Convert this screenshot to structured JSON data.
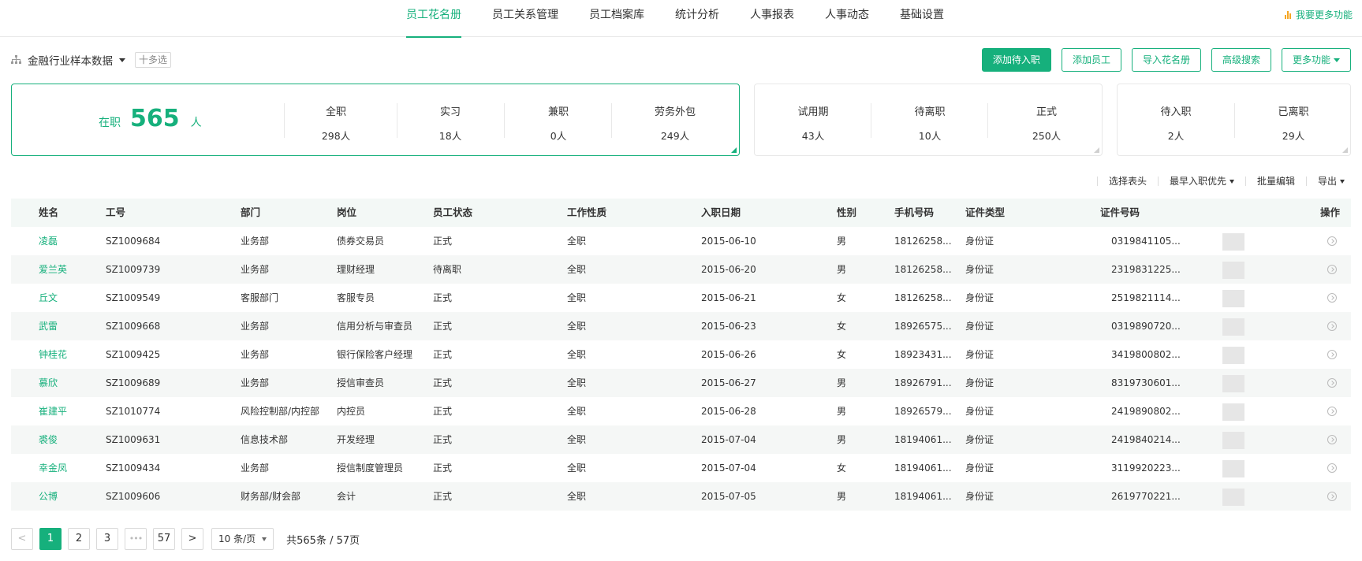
{
  "nav": {
    "tabs": [
      {
        "label": "员工花名册",
        "active": true
      },
      {
        "label": "员工关系管理",
        "active": false
      },
      {
        "label": "员工档案库",
        "active": false
      },
      {
        "label": "统计分析",
        "active": false
      },
      {
        "label": "人事报表",
        "active": false
      },
      {
        "label": "人事动态",
        "active": false
      },
      {
        "label": "基础设置",
        "active": false
      }
    ],
    "more_label": "我要更多功能"
  },
  "toolbar": {
    "dataset_label": "金融行业样本数据",
    "multi_label": "十多选",
    "buttons": [
      "添加待入职",
      "添加员工",
      "导入花名册",
      "高级搜索",
      "更多功能"
    ]
  },
  "stats": {
    "main": {
      "label": "在职",
      "value": "565",
      "unit": "人"
    },
    "type_cells": [
      {
        "title": "全职",
        "value": "298人"
      },
      {
        "title": "实习",
        "value": "18人"
      },
      {
        "title": "兼职",
        "value": "0人"
      },
      {
        "title": "劳务外包",
        "value": "249人"
      }
    ],
    "status_cells": [
      {
        "title": "试用期",
        "value": "43人"
      },
      {
        "title": "待离职",
        "value": "10人"
      },
      {
        "title": "正式",
        "value": "250人"
      }
    ],
    "flow_cells": [
      {
        "title": "待入职",
        "value": "2人"
      },
      {
        "title": "已离职",
        "value": "29人"
      }
    ]
  },
  "table_actions": [
    "选择表头",
    "最早入职优先",
    "批量编辑",
    "导出"
  ],
  "table": {
    "headers": [
      "姓名",
      "工号",
      "部门",
      "岗位",
      "员工状态",
      "工作性质",
      "入职日期",
      "性别",
      "手机号码",
      "证件类型",
      "证件号码",
      "操作"
    ],
    "rows": [
      [
        "凌磊",
        "SZ1009684",
        "业务部",
        "债券交易员",
        "正式",
        "全职",
        "2015-06-10",
        "男",
        "18126258...",
        "身份证",
        "0319841105..."
      ],
      [
        "爱兰英",
        "SZ1009739",
        "业务部",
        "理财经理",
        "待离职",
        "全职",
        "2015-06-20",
        "男",
        "18126258...",
        "身份证",
        "2319831225..."
      ],
      [
        "丘文",
        "SZ1009549",
        "客服部门",
        "客服专员",
        "正式",
        "全职",
        "2015-06-21",
        "女",
        "18126258...",
        "身份证",
        "2519821114..."
      ],
      [
        "武雷",
        "SZ1009668",
        "业务部",
        "信用分析与审查员",
        "正式",
        "全职",
        "2015-06-23",
        "女",
        "18926575...",
        "身份证",
        "0319890720..."
      ],
      [
        "钟桂花",
        "SZ1009425",
        "业务部",
        "银行保险客户经理",
        "正式",
        "全职",
        "2015-06-26",
        "女",
        "18923431...",
        "身份证",
        "3419800802..."
      ],
      [
        "慕欣",
        "SZ1009689",
        "业务部",
        "授信审查员",
        "正式",
        "全职",
        "2015-06-27",
        "男",
        "18926791...",
        "身份证",
        "8319730601..."
      ],
      [
        "崔建平",
        "SZ1010774",
        "风险控制部/内控部",
        "内控员",
        "正式",
        "全职",
        "2015-06-28",
        "男",
        "18926579...",
        "身份证",
        "2419890802..."
      ],
      [
        "裘俊",
        "SZ1009631",
        "信息技术部",
        "开发经理",
        "正式",
        "全职",
        "2015-07-04",
        "男",
        "18194061...",
        "身份证",
        "2419840214..."
      ],
      [
        "幸金凤",
        "SZ1009434",
        "业务部",
        "授信制度管理员",
        "正式",
        "全职",
        "2015-07-04",
        "女",
        "18194061...",
        "身份证",
        "3119920223..."
      ],
      [
        "公博",
        "SZ1009606",
        "财务部/财会部",
        "会计",
        "正式",
        "全职",
        "2015-07-05",
        "男",
        "18194061...",
        "身份证",
        "2619770221..."
      ]
    ]
  },
  "pagination": {
    "prev": "<",
    "pages": [
      "1",
      "2",
      "3"
    ],
    "ellipsis": "•••",
    "last": "57",
    "next": ">",
    "page_size": "10 条/页",
    "total": "共565条 / 57页"
  },
  "colors": {
    "accent": "#16b07c",
    "warning_icon": "#f5a623"
  }
}
